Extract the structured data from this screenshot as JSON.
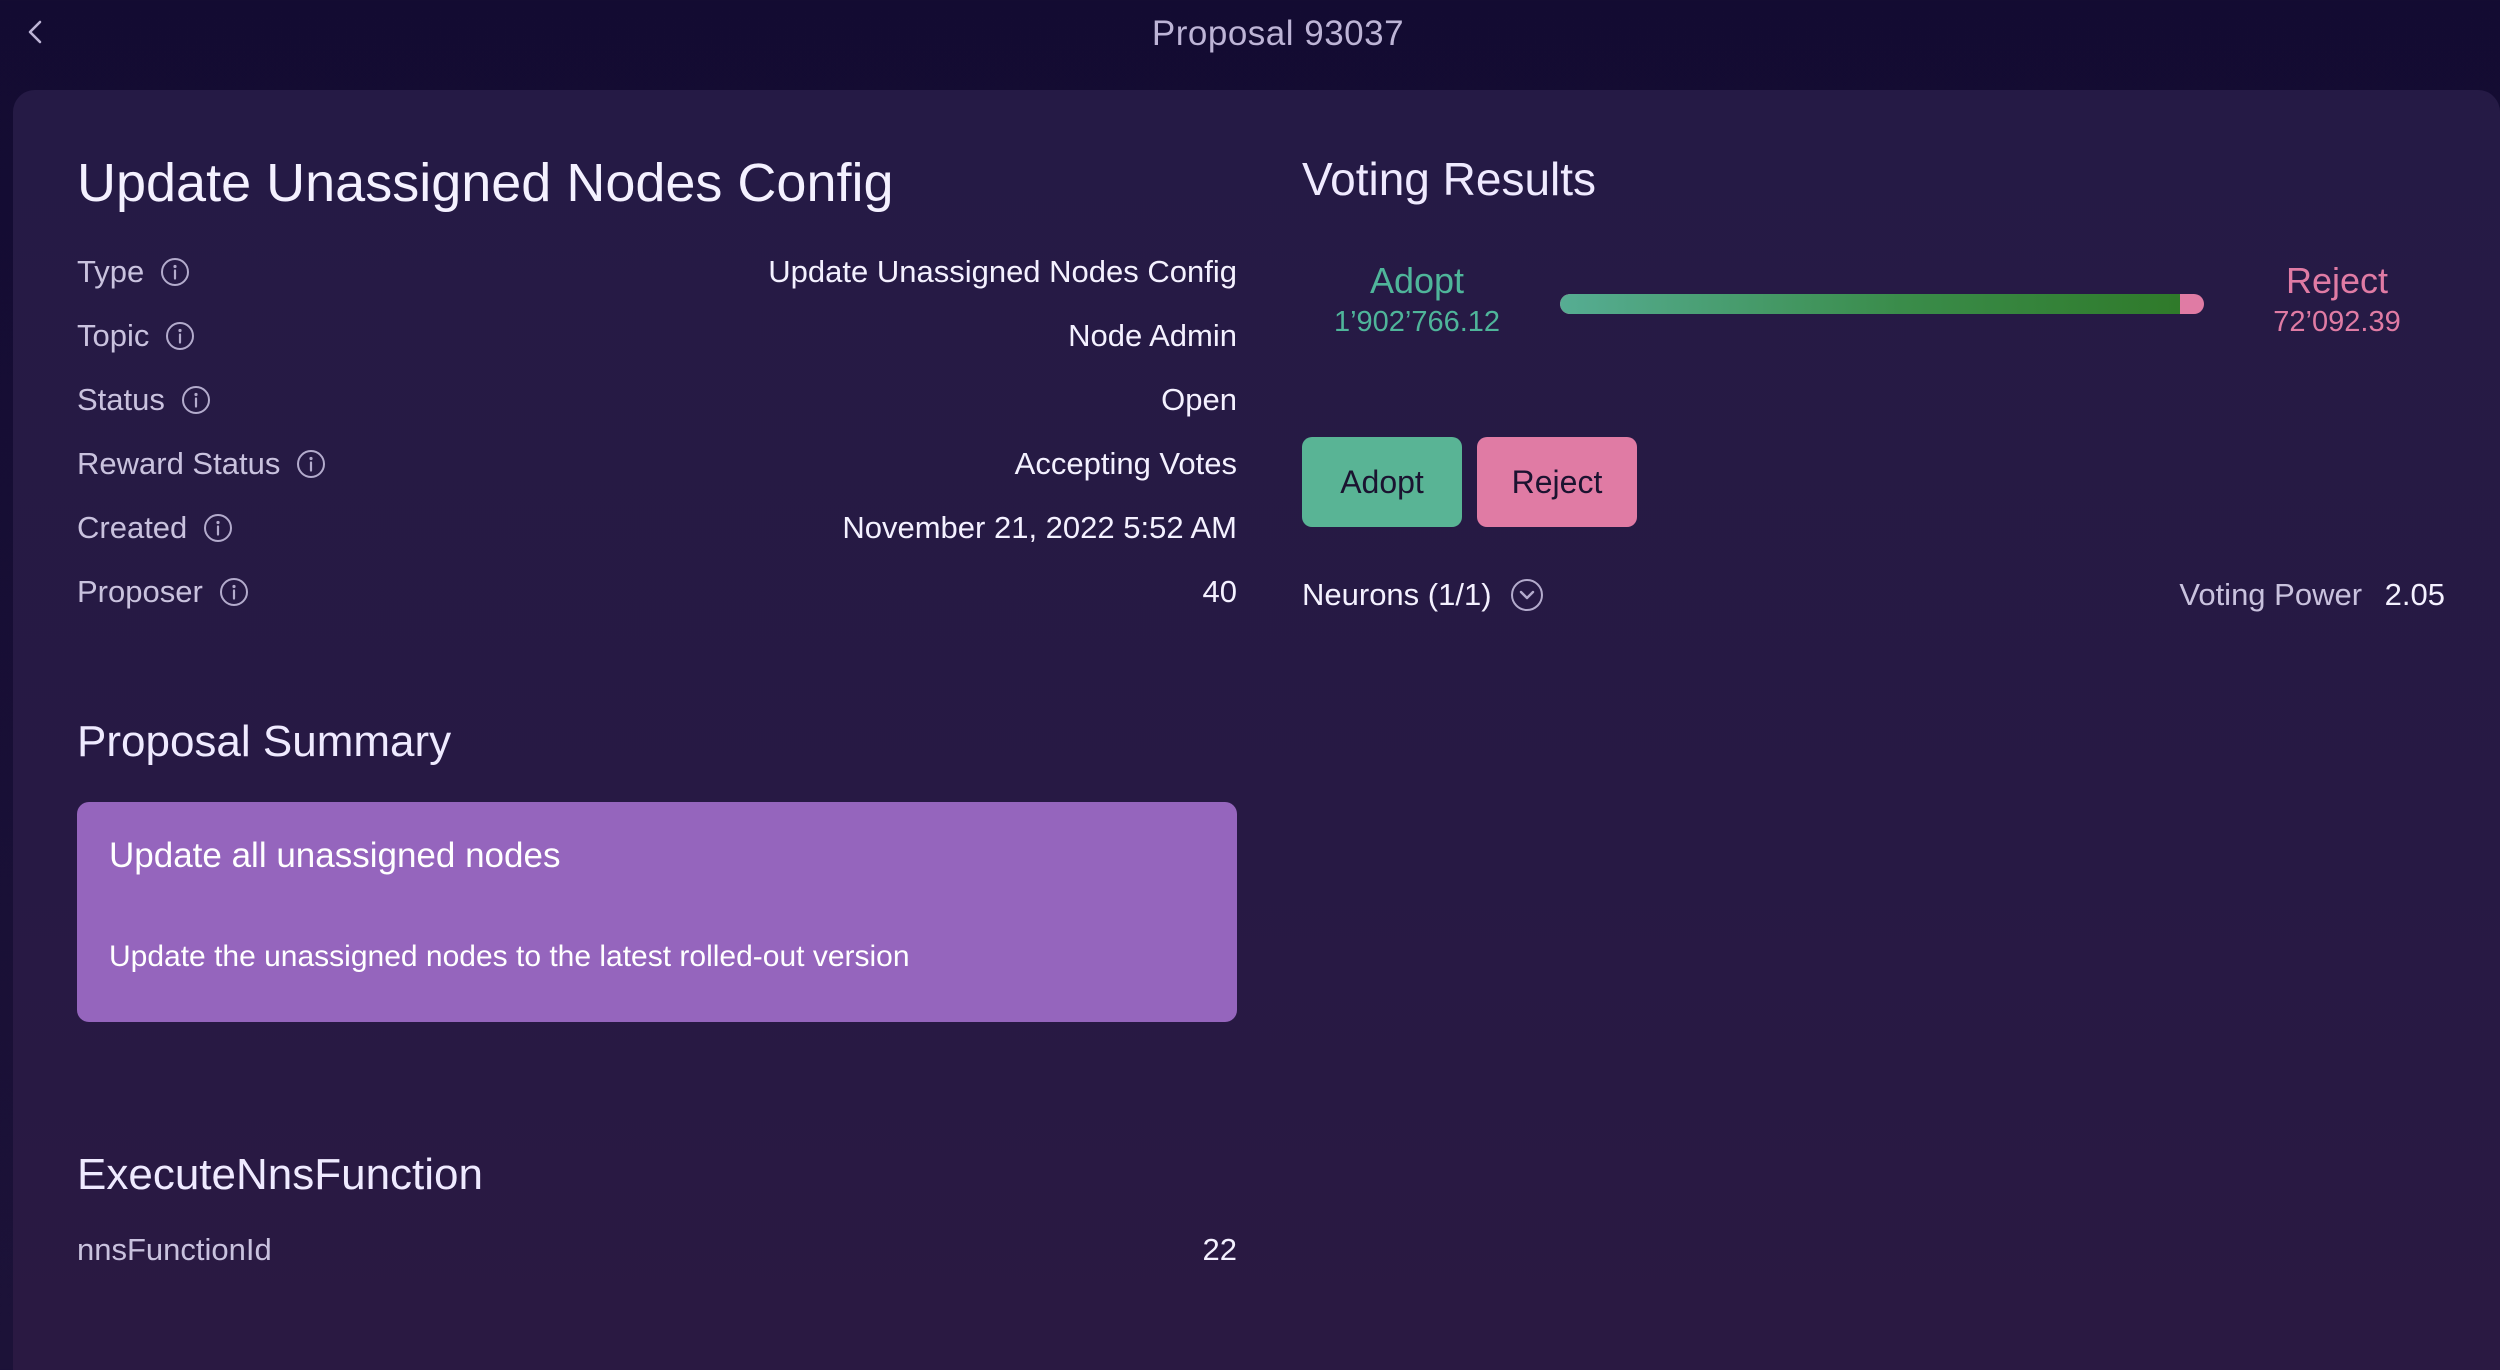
{
  "header": {
    "title": "Proposal 93037",
    "back_icon": "chevron-left-icon"
  },
  "proposal": {
    "title": "Update Unassigned Nodes Config",
    "info": [
      {
        "label": "Type",
        "value": "Update Unassigned Nodes Config"
      },
      {
        "label": "Topic",
        "value": "Node Admin"
      },
      {
        "label": "Status",
        "value": "Open"
      },
      {
        "label": "Reward Status",
        "value": "Accepting Votes"
      },
      {
        "label": "Created",
        "value": "November 21, 2022 5:52 AM"
      },
      {
        "label": "Proposer",
        "value": "40"
      }
    ],
    "info_icon": "info-circle-icon"
  },
  "summary": {
    "section_title": "Proposal Summary",
    "heading": "Update all unassigned nodes",
    "body": "Update the unassigned nodes to the latest rolled-out version",
    "card_color": "#9565bd"
  },
  "execute": {
    "section_title": "ExecuteNnsFunction",
    "label": "nnsFunctionId",
    "value": "22"
  },
  "voting": {
    "title": "Voting Results",
    "adopt_label": "Adopt",
    "adopt_value": "1’902’766.12",
    "reject_label": "Reject",
    "reject_value": "72’092.39",
    "adopt_fraction": 0.9635,
    "adopt_color": "#4fb59a",
    "reject_color": "#e07ba4",
    "adopt_button": "Adopt",
    "reject_button": "Reject",
    "neurons_label": "Neurons (1/1)",
    "neurons_icon": "chevron-down-circle-icon",
    "voting_power_label": "Voting Power",
    "voting_power_value": "2.05"
  }
}
